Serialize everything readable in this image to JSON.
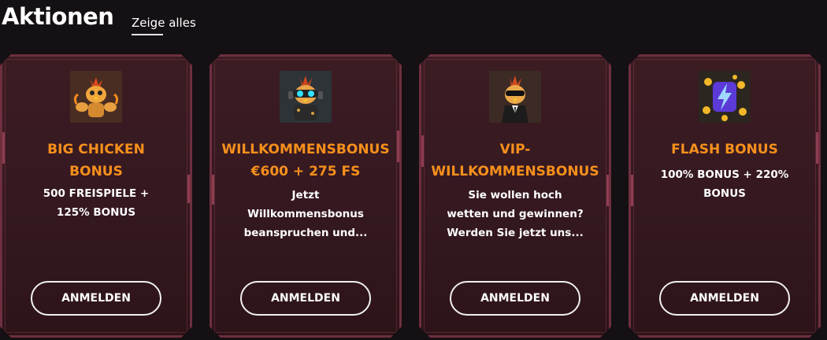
{
  "header": {
    "title": "Aktionen",
    "show_all": "Zeige alles"
  },
  "cards": [
    {
      "title_line1": "BIG CHICKEN",
      "title_line2": "BONUS",
      "desc_lines": [
        "500 FREISPIELE +",
        "125% BONUS"
      ],
      "button": "ANMELDEN",
      "icon": "muscle-chicken-icon"
    },
    {
      "title_line1": "WILLKOMMENSBONUS",
      "title_line2": "€600 + 275 FS",
      "desc_lines": [
        "Jetzt",
        "Willkommensbonus",
        "beanspruchen und..."
      ],
      "button": "ANMELDEN",
      "icon": "goggles-chicken-icon"
    },
    {
      "title_line1": "VIP-",
      "title_line2": "WILLKOMMENSBONUS",
      "desc_lines": [
        "Sie wollen hoch",
        "wetten und gewinnen?",
        "Werden Sie jetzt uns..."
      ],
      "button": "ANMELDEN",
      "icon": "vip-suit-chicken-icon"
    },
    {
      "title_line1": "FLASH BONUS",
      "title_line2": "",
      "desc_lines": [
        "100% BONUS + 220%",
        "BONUS"
      ],
      "button": "ANMELDEN",
      "icon": "lightning-coins-icon"
    }
  ],
  "colors": {
    "accent": "#f6901c",
    "card_border": "#6e2f3e",
    "background": "#141013"
  }
}
